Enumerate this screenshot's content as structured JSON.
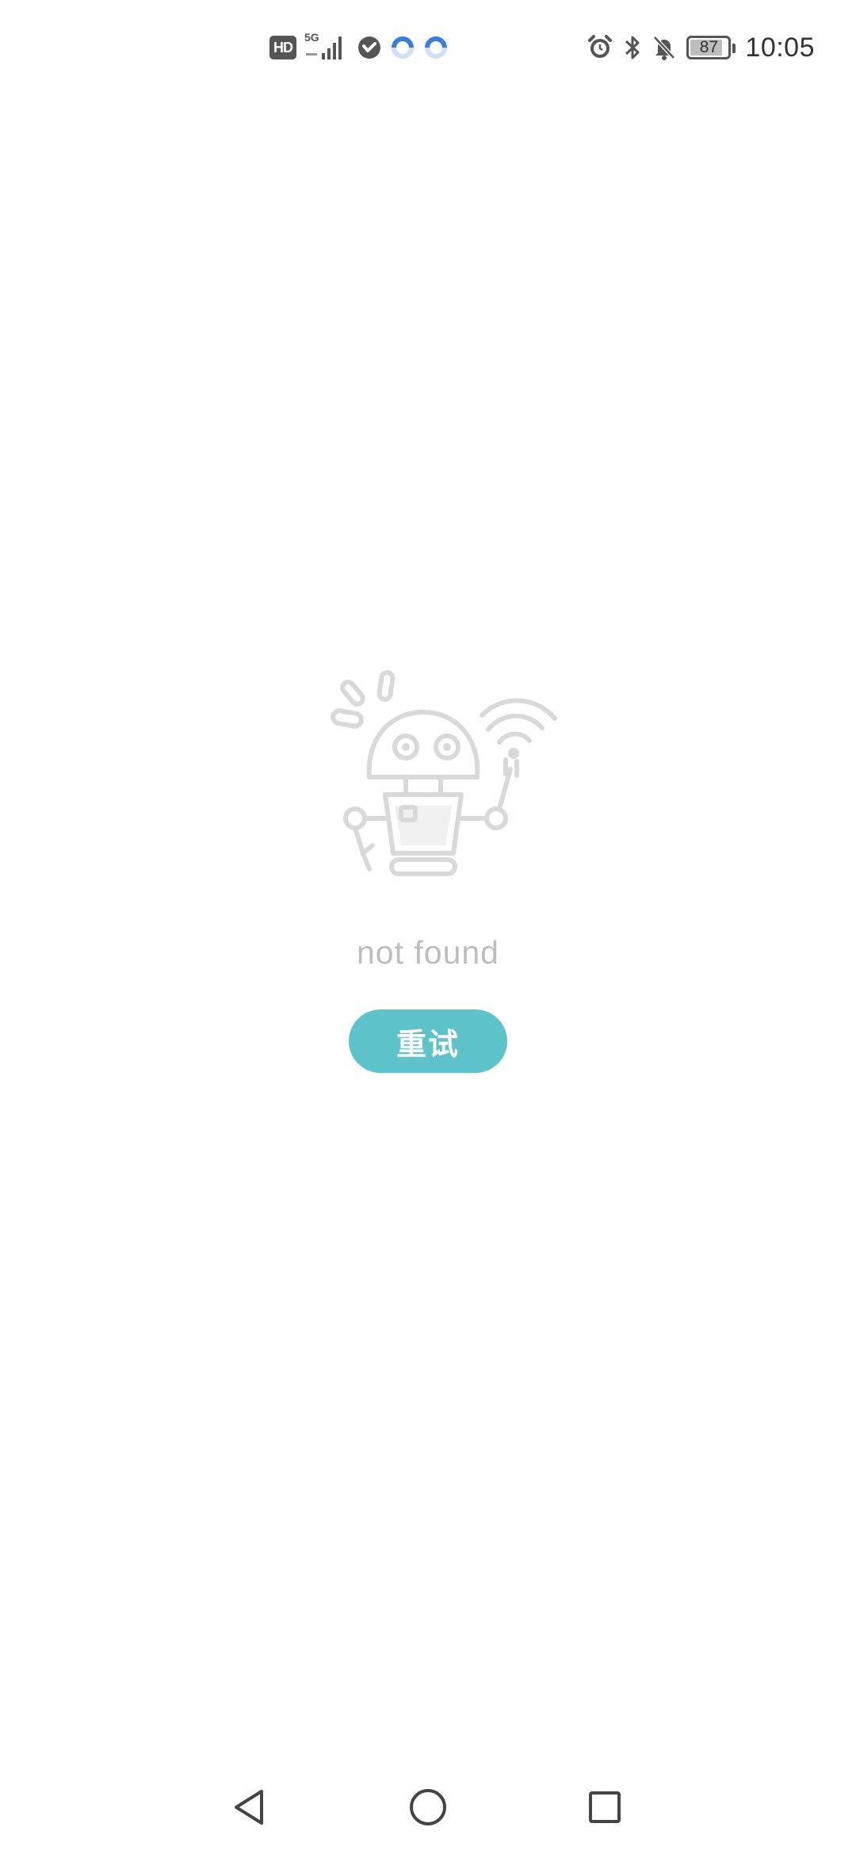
{
  "status_bar": {
    "hd_label": "HD",
    "network_label": "5G",
    "battery_level": "87",
    "time": "10:05",
    "icons_left": [
      "hd-icon",
      "signal-icon",
      "heart-shield-icon",
      "loading-ring-icon",
      "loading-ring-icon"
    ],
    "icons_right": [
      "alarm-icon",
      "bluetooth-icon",
      "bell-muted-icon",
      "battery-icon"
    ]
  },
  "main": {
    "illustration": "robot-icon",
    "message": "not found",
    "retry_label": "重试"
  },
  "nav_bar": {
    "icons": [
      "back-triangle-icon",
      "home-circle-icon",
      "recent-square-icon"
    ]
  },
  "colors": {
    "accent": "#5ec2cb",
    "message_text": "#bdbdbd",
    "illustration_stroke": "#d9d9d9",
    "status_icons": "#555555",
    "loading_ring": "#3b7ddd",
    "background": "#ffffff"
  }
}
